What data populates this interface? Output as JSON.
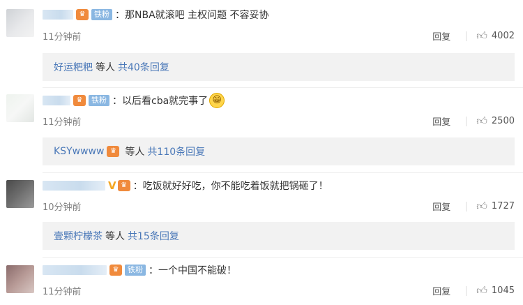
{
  "comments": [
    {
      "fan_badge": "铁粉",
      "text": "：那NBA就滚吧 主权问题 不容妥协",
      "time": "11分钟前",
      "reply_label": "回复",
      "likes": "4002",
      "sub_user": "好运粑粑",
      "sub_etc": "等人",
      "sub_count": "共40条回复"
    },
    {
      "fan_badge": "铁粉",
      "text": "：以后看cba就完事了",
      "emoji": "😁",
      "time": "11分钟前",
      "reply_label": "回复",
      "likes": "2500",
      "sub_user": "KSYwwww",
      "sub_etc": "等人",
      "sub_count": "共110条回复"
    },
    {
      "text": "：吃饭就好好吃，你不能吃着饭就把锅砸了！",
      "time": "10分钟前",
      "reply_label": "回复",
      "likes": "1727",
      "sub_user": "壹颗柠檬茶",
      "sub_etc": "等人",
      "sub_count": "共15条回复"
    },
    {
      "fan_badge": "铁粉",
      "text": "：一个中国不能破！",
      "time": "11分钟前",
      "reply_label": "回复",
      "likes": "1045"
    }
  ],
  "icons": {
    "like": "thumbs-up-icon",
    "badge": "crown-badge-icon",
    "verified": "v-verified-icon"
  },
  "colors": {
    "link": "#4a78b8",
    "fan_badge": "#8ab7e2",
    "sub_bg": "#f2f2f2"
  }
}
